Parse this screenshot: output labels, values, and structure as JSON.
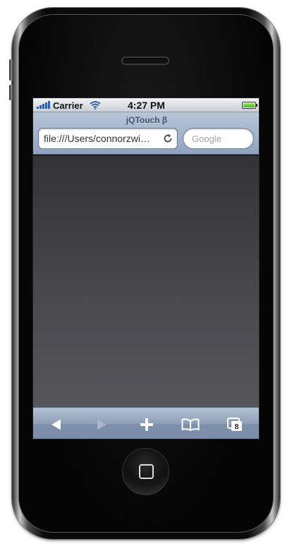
{
  "status_bar": {
    "carrier": "Carrier",
    "time": "4:27 PM",
    "signal_icon": "signal-bars-icon",
    "wifi_icon": "wifi-icon",
    "battery_icon": "battery-icon",
    "battery_level": 1.0
  },
  "browser": {
    "page_title": "jQTouch β",
    "url": "file:///Users/connorzwi…",
    "search_placeholder": "Google",
    "reload_icon": "reload-icon"
  },
  "toolbar": {
    "back_icon": "back-arrow-icon",
    "forward_icon": "forward-arrow-icon",
    "add_icon": "plus-icon",
    "bookmarks_icon": "bookmarks-icon",
    "pages_icon": "pages-icon",
    "pages_count": "8"
  },
  "colors": {
    "title_bar": "#8fa3bf",
    "toolbar": "#8e9fb8",
    "content": "#3f3f43"
  }
}
